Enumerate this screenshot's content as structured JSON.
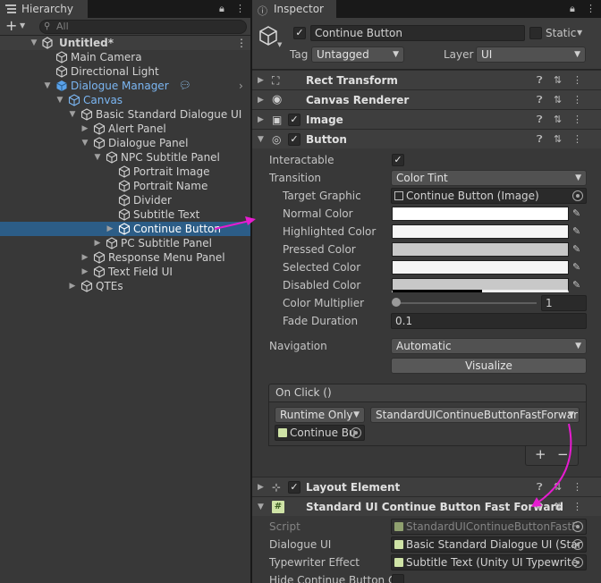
{
  "hierarchy": {
    "tab_title": "Hierarchy",
    "add_label": "+",
    "search_placeholder": "All",
    "items": [
      {
        "label": "Untitled*"
      },
      {
        "label": "Main Camera"
      },
      {
        "label": "Directional Light"
      },
      {
        "label": "Dialogue Manager"
      },
      {
        "label": "Canvas"
      },
      {
        "label": "Basic Standard Dialogue UI"
      },
      {
        "label": "Alert Panel"
      },
      {
        "label": "Dialogue Panel"
      },
      {
        "label": "NPC Subtitle Panel"
      },
      {
        "label": "Portrait Image"
      },
      {
        "label": "Portrait Name"
      },
      {
        "label": "Divider"
      },
      {
        "label": "Subtitle Text"
      },
      {
        "label": "Continue Button"
      },
      {
        "label": "PC Subtitle Panel"
      },
      {
        "label": "Response Menu Panel"
      },
      {
        "label": "Text Field UI"
      },
      {
        "label": "QTEs"
      }
    ]
  },
  "inspector": {
    "tab_title": "Inspector",
    "object_name": "Continue Button",
    "static_label": "Static",
    "tag_label": "Tag",
    "tag_value": "Untagged",
    "layer_label": "Layer",
    "layer_value": "UI",
    "components": {
      "rect_transform": "Rect Transform",
      "canvas_renderer": "Canvas Renderer",
      "image": "Image",
      "button": "Button",
      "layout_element": "Layout Element",
      "fast_forward": "Standard UI Continue Button Fast Forward"
    },
    "button": {
      "interactable_label": "Interactable",
      "transition_label": "Transition",
      "transition_value": "Color Tint",
      "target_graphic_label": "Target Graphic",
      "target_graphic_value": "Continue Button (Image)",
      "normal_color_label": "Normal Color",
      "highlighted_color_label": "Highlighted Color",
      "pressed_color_label": "Pressed Color",
      "selected_color_label": "Selected Color",
      "disabled_color_label": "Disabled Color",
      "color_multiplier_label": "Color Multiplier",
      "color_multiplier_value": "1",
      "color_multiplier_slider": 0,
      "fade_duration_label": "Fade Duration",
      "fade_duration_value": "0.1",
      "navigation_label": "Navigation",
      "navigation_value": "Automatic",
      "visualize_label": "Visualize",
      "onclick_label": "On Click ()",
      "runtime_value": "Runtime Only",
      "function_value": "StandardUIContinueButtonFastForwar",
      "object_value": "Continue Bu",
      "plus_label": "+",
      "minus_label": "−"
    },
    "fast_forward": {
      "script_label": "Script",
      "script_value": "StandardUIContinueButtonFastF",
      "dialogue_ui_label": "Dialogue UI",
      "dialogue_ui_value": "Basic Standard Dialogue UI (Star",
      "typewriter_label": "Typewriter Effect",
      "typewriter_value": "Subtitle Text (Unity UI Typewrite",
      "hide_label": "Hide Continue Button Or"
    }
  },
  "colors": {
    "selection": "#2c5d87",
    "accent_arrow": "#e61cd0",
    "link_blue": "#7bb6f2"
  }
}
